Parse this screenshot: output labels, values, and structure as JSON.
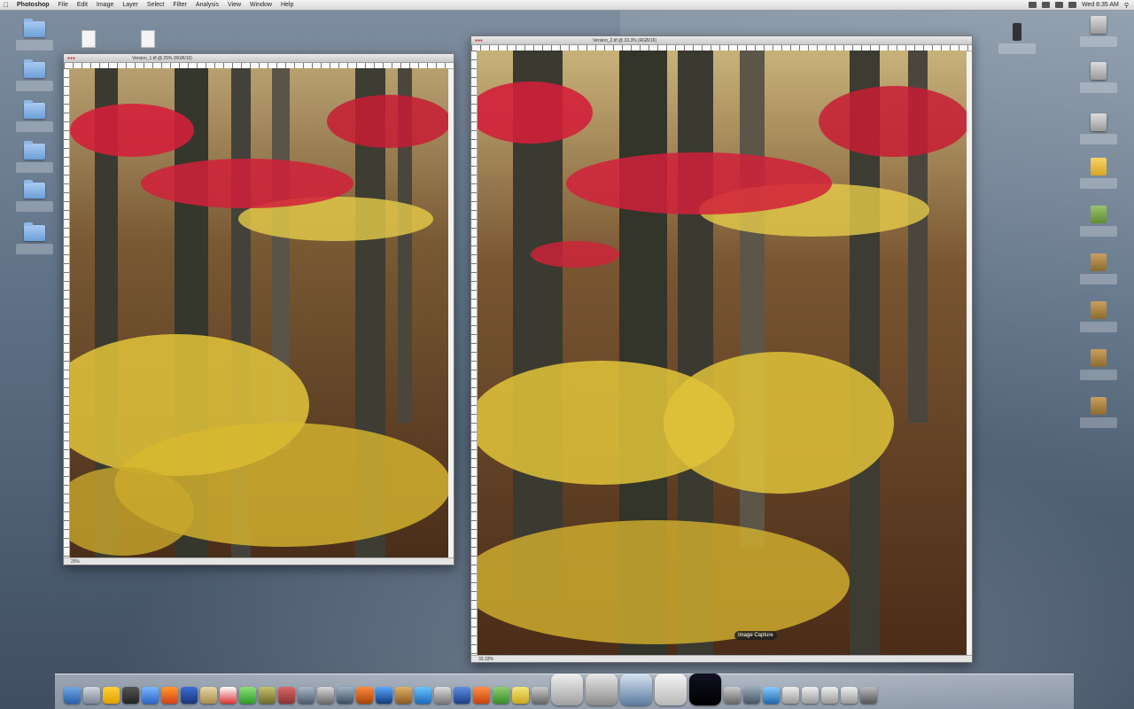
{
  "menubar": {
    "app": "Photoshop",
    "items": [
      "File",
      "Edit",
      "Image",
      "Layer",
      "Select",
      "Filter",
      "Analysis",
      "View",
      "Window",
      "Help"
    ],
    "clock": "Wed 8:35 AM"
  },
  "windows": [
    {
      "title": "Version_1.tif @ 25% (RGB/16)",
      "status": "25%"
    },
    {
      "title": "Version_2.tif @ 33.3% (RGB/16)",
      "status": "33.33%"
    }
  ],
  "dock": {
    "tooltip": "Image Capture"
  },
  "colors": {
    "sky": "#c8b27a",
    "foliage_red": "#d2203a",
    "foliage_yellow": "#e2c43a",
    "forest_floor": "#5a3a22",
    "trunk": "#3a3a30"
  }
}
